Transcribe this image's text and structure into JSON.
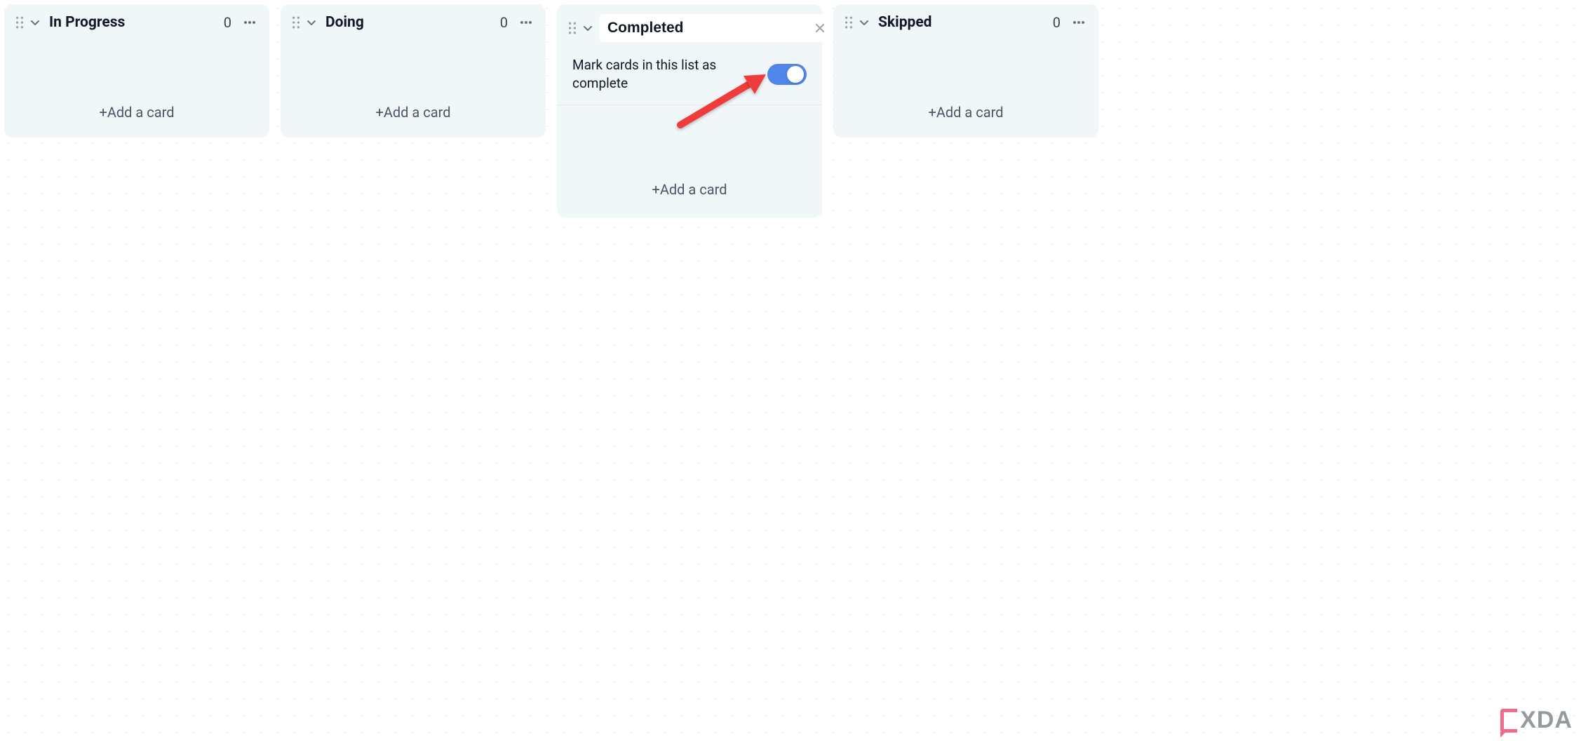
{
  "lists": [
    {
      "title": "In Progress",
      "count": "0",
      "add_label": "+Add a card",
      "editing": false
    },
    {
      "title": "Doing",
      "count": "0",
      "add_label": "+Add a card",
      "editing": false
    },
    {
      "title": "Completed",
      "count": "",
      "add_label": "+Add a card",
      "editing": true,
      "toggle_label": "Mark cards in this list as complete",
      "toggle_on": true
    },
    {
      "title": "Skipped",
      "count": "0",
      "add_label": "+Add a card",
      "editing": false
    }
  ],
  "watermark": "XDA"
}
